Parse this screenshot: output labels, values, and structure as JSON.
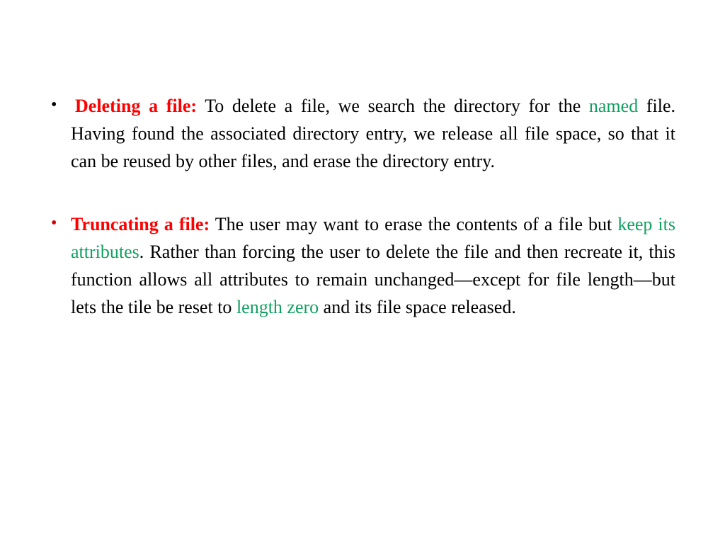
{
  "bullets": [
    {
      "heading": "Deleting a file:",
      "part1": " To delete a file, we search the directory for the ",
      "green1": "named",
      "part2": " file. Having found the associated directory entry, we release all file space, so that it can be reused by other files, and erase the directory entry."
    },
    {
      "heading": "Truncating a file:",
      "part1": " The user may want to erase the contents of a file but ",
      "green1": "keep its attributes",
      "part2": ". Rather than forcing the user to delete the file and then recreate it, this function allows all attributes to remain unchanged—except for file length—but lets the tile be reset to ",
      "green2": "length zero",
      "part3": " and its file space released."
    }
  ]
}
